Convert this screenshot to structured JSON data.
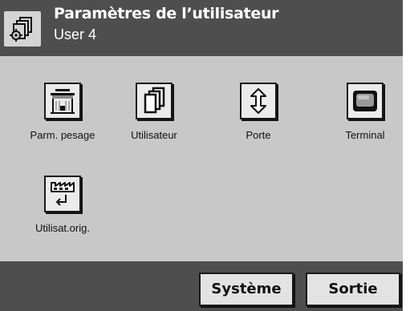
{
  "header": {
    "title": "Paramètres de l’utilisateur",
    "subtitle": "User 4",
    "icon": "user-settings-icon"
  },
  "tiles": [
    {
      "label": "Parm. pesage",
      "icon": "weighing-icon"
    },
    {
      "label": "Utilisateur",
      "icon": "user-pages-icon"
    },
    {
      "label": "Porte",
      "icon": "door-arrow-icon"
    },
    {
      "label": "Terminal",
      "icon": "terminal-icon"
    },
    {
      "label": "Utilisat.orig.",
      "icon": "factory-reset-icon"
    }
  ],
  "footer": {
    "system_label": "Système",
    "exit_label": "Sortie"
  },
  "colors": {
    "header_bg": "#4e4e4e",
    "body_bg": "#c8c8c8",
    "button_bg": "#ebebeb"
  }
}
